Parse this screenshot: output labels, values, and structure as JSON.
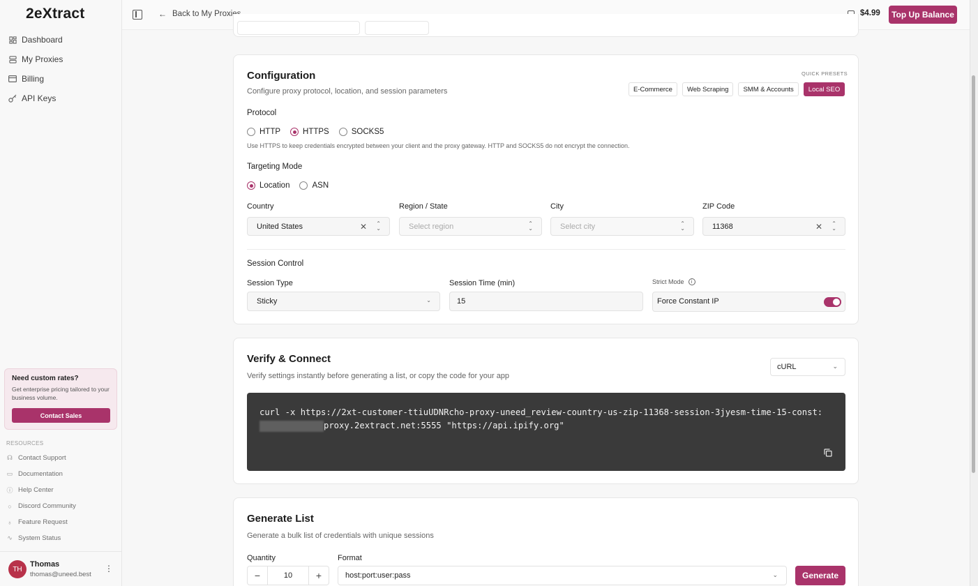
{
  "app": {
    "logo": "2eXtract"
  },
  "sidebar": {
    "nav": [
      {
        "label": "Dashboard",
        "icon": "dashboard-icon"
      },
      {
        "label": "My Proxies",
        "icon": "server-icon"
      },
      {
        "label": "Billing",
        "icon": "credit-card-icon"
      },
      {
        "label": "API Keys",
        "icon": "key-icon"
      }
    ],
    "promo": {
      "title": "Need custom rates?",
      "text": "Get enterprise pricing tailored to your business volume.",
      "button": "Contact Sales"
    },
    "resources_title": "RESOURCES",
    "resources": [
      {
        "label": "Contact Support",
        "icon": "headset-icon"
      },
      {
        "label": "Documentation",
        "icon": "book-icon"
      },
      {
        "label": "Help Center",
        "icon": "help-circle-icon"
      },
      {
        "label": "Discord Community",
        "icon": "chat-icon"
      },
      {
        "label": "Feature Request",
        "icon": "lightbulb-icon"
      },
      {
        "label": "System Status",
        "icon": "activity-icon"
      }
    ],
    "user": {
      "initials": "TH",
      "name": "Thomas",
      "email": "thomas@uneed.best"
    }
  },
  "topbar": {
    "back": "Back to My Proxies",
    "balance": "$4.99",
    "topup": "Top Up Balance"
  },
  "config": {
    "title": "Configuration",
    "subtitle": "Configure proxy protocol, location, and session parameters",
    "presets_label": "QUICK PRESETS",
    "presets": [
      "E-Commerce",
      "Web Scraping",
      "SMM & Accounts",
      "Local SEO"
    ],
    "active_preset": "Local SEO",
    "protocol_label": "Protocol",
    "protocols": [
      "HTTP",
      "HTTPS",
      "SOCKS5"
    ],
    "selected_protocol": "HTTPS",
    "protocol_hint": "Use HTTPS to keep credentials encrypted between your client and the proxy gateway. HTTP and SOCKS5 do not encrypt the connection.",
    "targeting_label": "Targeting Mode",
    "targeting": [
      "Location",
      "ASN"
    ],
    "selected_targeting": "Location",
    "country_label": "Country",
    "country_value": "United States",
    "region_label": "Region / State",
    "region_placeholder": "Select region",
    "city_label": "City",
    "city_placeholder": "Select city",
    "zip_label": "ZIP Code",
    "zip_value": "11368",
    "session_control": "Session Control",
    "session_type_label": "Session Type",
    "session_type_value": "Sticky",
    "session_time_label": "Session Time (min)",
    "session_time_value": "15",
    "strict_label": "Strict Mode",
    "force_ip_label": "Force Constant IP",
    "force_ip_on": true
  },
  "verify": {
    "title": "Verify & Connect",
    "subtitle": "Verify settings instantly before generating a list, or copy the code for your app",
    "language": "cURL",
    "code_part1": "curl -x https://2xt-customer-ttiuUDNRcho-proxy-uneed_review-country-us-zip-11368-session-3jyesm-time-15-const:",
    "code_part2": "proxy.2extract.net:5555 \"https://api.ipify.org\""
  },
  "generate": {
    "title": "Generate List",
    "subtitle": "Generate a bulk list of credentials with unique sessions",
    "quantity_label": "Quantity",
    "quantity": "10",
    "format_label": "Format",
    "format": "host:port:user:pass",
    "button": "Generate"
  },
  "colors": {
    "accent": "#a9336a",
    "code_bg": "#3a3a3a"
  }
}
